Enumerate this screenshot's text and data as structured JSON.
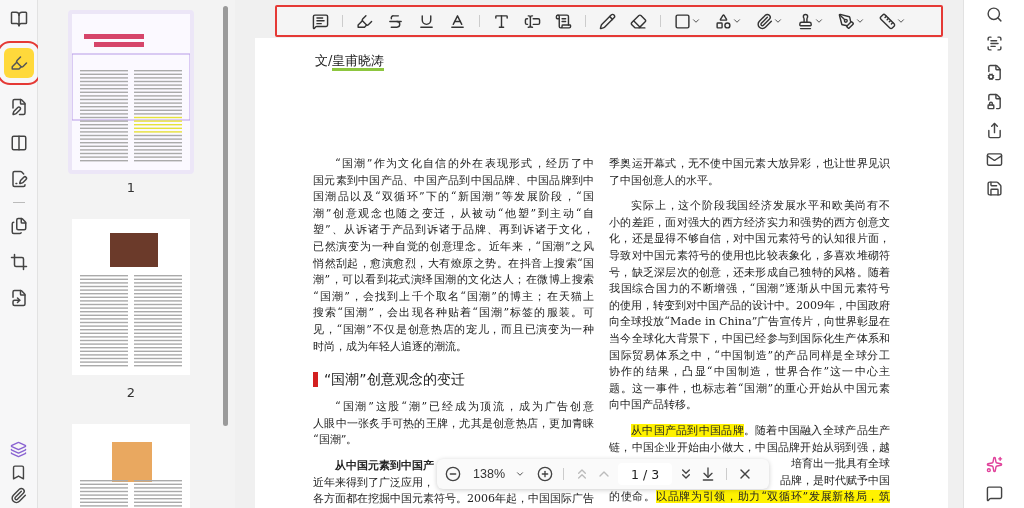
{
  "left_rail": {
    "items": [
      {
        "selected": false
      },
      {
        "selected": true
      },
      {
        "selected": false
      },
      {
        "selected": false
      },
      {
        "selected": false
      },
      {
        "selected": false
      },
      {
        "selected": false
      },
      {
        "selected": false
      }
    ]
  },
  "thumbnails": [
    {
      "label": "1",
      "selected": true,
      "kind": "cover"
    },
    {
      "label": "2",
      "selected": false,
      "kind": "photo"
    },
    {
      "selected": false,
      "kind": "figure"
    }
  ],
  "document": {
    "author": {
      "prefix": "文/",
      "name": "皇甫晓涛",
      "underlined": true
    },
    "columns": [
      {
        "blocks": [
          {
            "kind": "paragraph",
            "indent": true,
            "lines": [
              {
                "kind": "full",
                "parts": [
                  {
                    "text": "“国潮”作为文化自信的外在表现形式，经历了中",
                    "highlighted": false
                  }
                ]
              },
              {
                "kind": "full",
                "parts": [
                  {
                    "text": "国元素到中国产品、中国产品到中国品牌、中国品牌到中",
                    "highlighted": false
                  }
                ]
              },
              {
                "kind": "full",
                "parts": [
                  {
                    "text": "国潮品以及“双循环”下的“新国潮”等发展阶段，“国",
                    "highlighted": false
                  }
                ]
              },
              {
                "kind": "full",
                "parts": [
                  {
                    "text": "潮”创意观念也随之变迁，从被动“他塑”到主动“自",
                    "highlighted": false
                  }
                ]
              },
              {
                "kind": "full",
                "parts": [
                  {
                    "text": "塑”、从诉诸于产品到诉诸于品牌、再到诉诸于文化，",
                    "highlighted": false
                  }
                ]
              },
              {
                "kind": "full",
                "parts": [
                  {
                    "text": "已然演变为一种自觉的创意理念。近年来，“国潮”之风",
                    "highlighted": false
                  }
                ]
              },
              {
                "kind": "full",
                "parts": [
                  {
                    "text": "悄然刮起，愈演愈烈，大有燎原之势。在抖音上搜索“国",
                    "highlighted": false
                  }
                ]
              },
              {
                "kind": "full",
                "parts": [
                  {
                    "text": "潮”，可以看到花式演绎国潮的文化达人；在微博上搜索",
                    "highlighted": false
                  }
                ]
              },
              {
                "kind": "full",
                "parts": [
                  {
                    "text": "“国潮”，会找到上千个取名“国潮”的博主；在天猫上",
                    "highlighted": false
                  }
                ]
              },
              {
                "kind": "full",
                "parts": [
                  {
                    "text": "搜索“国潮”，会出现各种贴着“国潮”标签的服装。可",
                    "highlighted": false
                  }
                ]
              },
              {
                "kind": "full",
                "parts": [
                  {
                    "text": "见，“国潮”不仅是创意热店的宠儿，而且已演变为一种",
                    "highlighted": false
                  }
                ]
              },
              {
                "kind": "last",
                "parts": [
                  {
                    "text": "时尚，成为年轻人追逐的潮流。",
                    "highlighted": false
                  }
                ]
              }
            ]
          },
          {
            "kind": "heading",
            "text": "“国潮”创意观念的变迁"
          },
          {
            "kind": "paragraph",
            "indent": true,
            "lines": [
              {
                "kind": "full",
                "parts": [
                  {
                    "text": "“国潮”这股“潮”已经成为顶流，成为广告创意",
                    "highlighted": false
                  }
                ]
              },
              {
                "kind": "full",
                "parts": [
                  {
                    "text": "人眼中一张炙手可热的王牌，尤其是创意热店，更加青睐",
                    "highlighted": false
                  }
                ]
              },
              {
                "kind": "last",
                "parts": [
                  {
                    "text": "“国潮”。",
                    "highlighted": false
                  }
                ]
              }
            ]
          },
          {
            "kind": "paragraph",
            "indent": true,
            "lines": [
              {
                "kind": "lead",
                "parts": [
                  {
                    "text": "从中国元素到中国产",
                    "highlighted": false
                  }
                ]
              },
              {
                "kind": "last",
                "parts": [
                  {
                    "text": "近年来得到了广泛应用，",
                    "highlighted": false
                  }
                ]
              },
              {
                "kind": "full",
                "parts": [
                  {
                    "text": "各方面都在挖掘中国元素符号。2006年起，中国国际广告",
                    "highlighted": false
                  }
                ]
              }
            ]
          }
        ]
      },
      {
        "blocks": [
          {
            "kind": "paragraph",
            "indent": false,
            "lines": [
              {
                "kind": "full",
                "parts": [
                  {
                    "text": "季奥运开幕式，无不使中国元素大放异彩，也让世界见识",
                    "highlighted": false
                  }
                ]
              },
              {
                "kind": "last",
                "parts": [
                  {
                    "text": "了中国创意人的水平。",
                    "highlighted": false
                  }
                ]
              }
            ]
          },
          {
            "kind": "paragraph",
            "indent": true,
            "lines": [
              {
                "kind": "full",
                "parts": [
                  {
                    "text": "实际上，这个阶段我国经济发展水平和欧美尚有不",
                    "highlighted": false
                  }
                ]
              },
              {
                "kind": "full",
                "parts": [
                  {
                    "text": "小的差距，面对强大的西方经济实力和强势的西方创意文",
                    "highlighted": false
                  }
                ]
              },
              {
                "kind": "full",
                "parts": [
                  {
                    "text": "化，还是显得不够自信，对中国元素符号的认知很片面，",
                    "highlighted": false
                  }
                ]
              },
              {
                "kind": "full",
                "parts": [
                  {
                    "text": "导致对中国元素符号的使用也比较表象化，多喜欢堆砌符",
                    "highlighted": false
                  }
                ]
              },
              {
                "kind": "full",
                "parts": [
                  {
                    "text": "号，缺乏深层次的创意，还未形成自己独特的风格。随着",
                    "highlighted": false
                  }
                ]
              },
              {
                "kind": "full",
                "parts": [
                  {
                    "text": "我国综合国力的不断增强，“国潮”逐渐从中国元素符号",
                    "highlighted": false
                  }
                ]
              },
              {
                "kind": "full",
                "parts": [
                  {
                    "text": "的使用，转变到对中国产品的设计中。2009年，中国政府",
                    "highlighted": false
                  }
                ]
              },
              {
                "kind": "full",
                "parts": [
                  {
                    "text": "向全球投放“Made in China”广告宣传片，向世界彰显在",
                    "highlighted": false
                  }
                ]
              },
              {
                "kind": "full",
                "parts": [
                  {
                    "text": "当今全球化大背景下，中国已经参与到国际化生产体系和",
                    "highlighted": false
                  }
                ]
              },
              {
                "kind": "full",
                "parts": [
                  {
                    "text": "国际贸易体系之中，“中国制造”的产品同样是全球分工",
                    "highlighted": false
                  }
                ]
              },
              {
                "kind": "full",
                "parts": [
                  {
                    "text": "协作的结果，凸显“中国制造，世界合作”这一中心主",
                    "highlighted": false
                  }
                ]
              },
              {
                "kind": "full",
                "parts": [
                  {
                    "text": "题。这一事件，也标志着“国潮”的重心开始从中国元素",
                    "highlighted": false
                  }
                ]
              },
              {
                "kind": "last",
                "parts": [
                  {
                    "text": "向中国产品转移。",
                    "highlighted": false
                  }
                ]
              }
            ]
          },
          {
            "kind": "paragraph",
            "indent": true,
            "lines": [
              {
                "kind": "full",
                "parts": [
                  {
                    "text": "从中国产品到中国品牌",
                    "highlighted": true
                  },
                  {
                    "text": "。随着中国融入全球产品生产",
                    "highlighted": false
                  }
                ]
              },
              {
                "kind": "full",
                "parts": [
                  {
                    "text": "链，中国企业开始由小做大，中国品牌开始从弱到强，越",
                    "highlighted": false
                  }
                ]
              },
              {
                "kind": "tail",
                "parts": [
                  {
                    "text": "培育出一批具有全球",
                    "highlighted": false
                  }
                ]
              },
              {
                "kind": "tail",
                "parts": [
                  {
                    "text": "品牌，是时代赋予中国",
                    "highlighted": false
                  }
                ]
              },
              {
                "kind": "full",
                "parts": [
                  {
                    "text": "的使命。",
                    "highlighted": false
                  },
                  {
                    "text": "以品牌为引领，助力“双循环”发展新格局，筑",
                    "highlighted": true
                  }
                ]
              }
            ]
          }
        ]
      }
    ]
  },
  "zoom_bar": {
    "zoom": "138%",
    "page": "1 / 3"
  }
}
